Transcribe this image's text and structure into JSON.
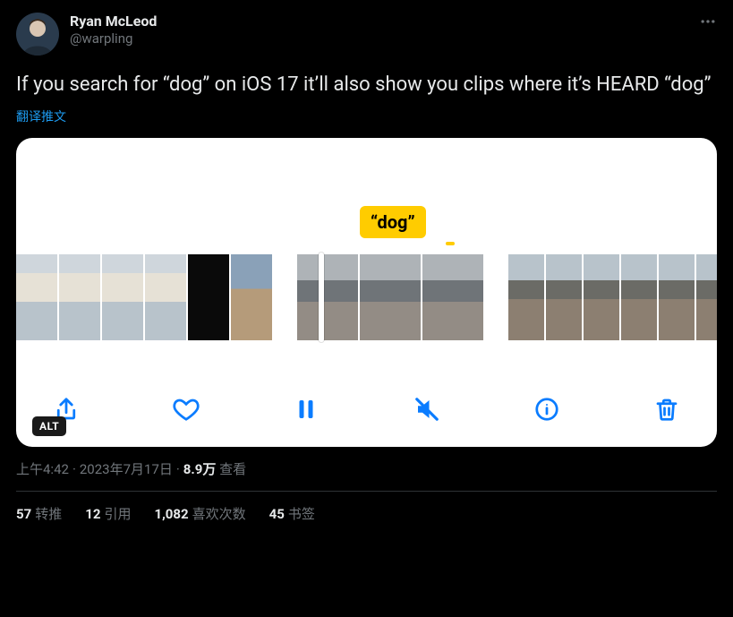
{
  "author": {
    "display_name": "Ryan McLeod",
    "handle": "@warpling"
  },
  "body": "If you search for “dog” on iOS 17 it’ll also show you clips where it’s HEARD “dog”",
  "translate_label": "翻译推文",
  "media": {
    "caption_chip": "“dog”",
    "alt_badge": "ALT",
    "toolbar": {
      "share_name": "share-icon",
      "heart_name": "heart-icon",
      "pause_name": "pause-icon",
      "mute_name": "mute-icon",
      "info_name": "info-icon",
      "trash_name": "trash-icon"
    }
  },
  "meta": {
    "time": "上午4:42",
    "date": "2023年7月17日",
    "views_number": "8.9万",
    "views_label": "查看",
    "dot": "·"
  },
  "stats": {
    "retweets": {
      "count": "57",
      "label": "转推"
    },
    "quotes": {
      "count": "12",
      "label": "引用"
    },
    "likes": {
      "count": "1,082",
      "label": "喜欢次数"
    },
    "bookmarks": {
      "count": "45",
      "label": "书签"
    }
  }
}
